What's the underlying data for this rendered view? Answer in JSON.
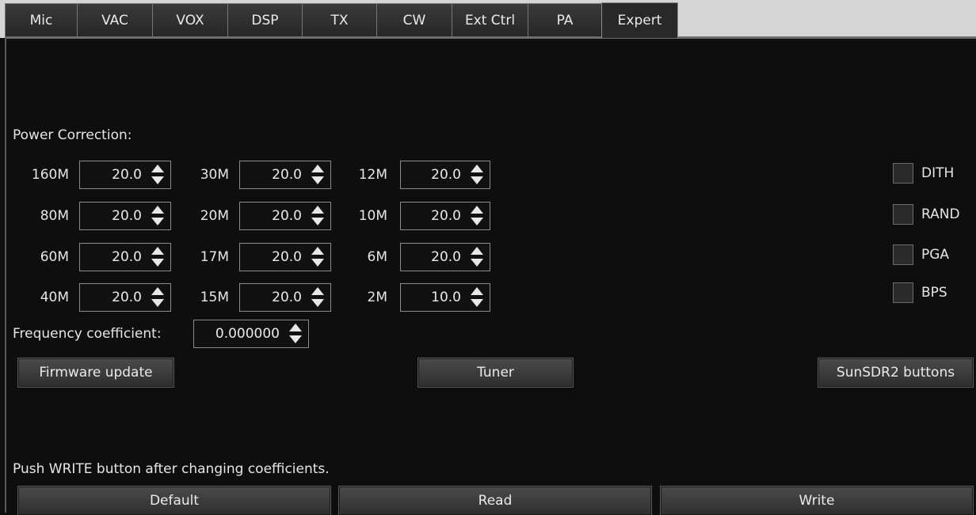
{
  "tabs": [
    {
      "label": "Mic"
    },
    {
      "label": "VAC"
    },
    {
      "label": "VOX"
    },
    {
      "label": "DSP"
    },
    {
      "label": "TX"
    },
    {
      "label": "CW"
    },
    {
      "label": "Ext Ctrl"
    },
    {
      "label": "PA"
    },
    {
      "label": "Expert"
    }
  ],
  "active_tab": "Expert",
  "power_correction": {
    "heading": "Power Correction:",
    "bands": [
      {
        "band": "160M",
        "value": "20.0"
      },
      {
        "band": "80M",
        "value": "20.0"
      },
      {
        "band": "60M",
        "value": "20.0"
      },
      {
        "band": "40M",
        "value": "20.0"
      },
      {
        "band": "30M",
        "value": "20.0"
      },
      {
        "band": "20M",
        "value": "20.0"
      },
      {
        "band": "17M",
        "value": "20.0"
      },
      {
        "band": "15M",
        "value": "20.0"
      },
      {
        "band": "12M",
        "value": "20.0"
      },
      {
        "band": "10M",
        "value": "20.0"
      },
      {
        "band": "6M",
        "value": "20.0"
      },
      {
        "band": "2M",
        "value": "10.0"
      }
    ]
  },
  "checkboxes": [
    {
      "label": "DITH",
      "checked": false
    },
    {
      "label": "RAND",
      "checked": false
    },
    {
      "label": "PGA",
      "checked": false
    },
    {
      "label": "BPS",
      "checked": false
    }
  ],
  "frequency": {
    "label": "Frequency coefficient:",
    "value": "0.000000"
  },
  "buttons": {
    "firmware": "Firmware update",
    "tuner": "Tuner",
    "sunsdr": "SunSDR2 buttons",
    "default": "Default",
    "read": "Read",
    "write": "Write"
  },
  "hint": "Push WRITE button after changing coefficients.",
  "colors": {
    "background": "#0e0e0e",
    "tabbar": "#d5d5d5",
    "text": "#e6e6e6"
  }
}
